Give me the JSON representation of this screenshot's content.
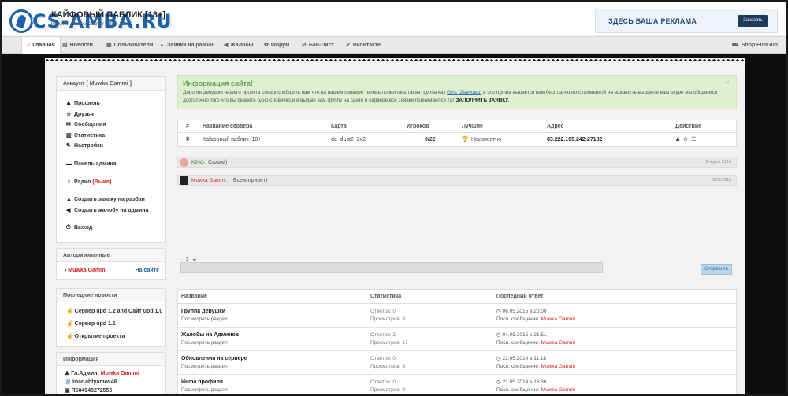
{
  "header": {
    "logo_text": "CS-AMBA.RU",
    "site_title": "КАЙФОВЫЙ ПАБЛИК [18+]",
    "site_sub": "Игровой сервер Counter-Strike 1.6",
    "ad_text": "ЗДЕСЬ ВАША РЕКЛАМА",
    "ad_button": "Заказать"
  },
  "nav": {
    "items": [
      {
        "label": "Главная",
        "icon": "home-icon"
      },
      {
        "label": "Новости",
        "icon": "newspaper-icon"
      },
      {
        "label": "Пользователи",
        "icon": "users-icon"
      },
      {
        "label": "Заявки на разбан",
        "icon": "warning-icon"
      },
      {
        "label": "Жалобы",
        "icon": "megaphone-icon"
      },
      {
        "label": "Форум",
        "icon": "forum-icon"
      },
      {
        "label": "Бан-Лист",
        "icon": "ban-icon"
      },
      {
        "label": "Вконтакте",
        "icon": "vk-icon"
      }
    ],
    "right": "Shop.FunGun"
  },
  "sidebar": {
    "account_title": "Аккаунт [ Muwka Gammi ]",
    "menu": [
      {
        "label": "Профиль",
        "icon": "user-icon"
      },
      {
        "label": "Друзья",
        "icon": "star-icon"
      },
      {
        "label": "Сообщения",
        "icon": "envelope-icon"
      },
      {
        "label": "Статистика",
        "icon": "chart-icon"
      },
      {
        "label": "Настройки",
        "icon": "wrench-icon"
      }
    ],
    "admin": "Панель админа",
    "radio": "Радио",
    "radio_state": "[Выкл]",
    "unban": "Создать заявку на разбан",
    "complaint": "Создать жалобу на админа",
    "logout": "Выход",
    "authorized_title": "Авторизованные",
    "authorized_user": "Muwka Gammi",
    "authorized_status": "На сайте",
    "news_title": "Последние новости",
    "news": [
      "Сервер upd 1.2 and Сайт upd 1.0",
      "Сервер upd 1.1",
      "Открытие проекта"
    ],
    "info_title": "Информация",
    "info_admin_label": "Гл.Админ:",
    "info_admin_name": "Muwka Gammi",
    "info_skype": "linar-ahtyamov46",
    "info_id": "R504945272555"
  },
  "alert": {
    "title": "Информация сайта!",
    "text_1": "Дорогие девушки нашего проекта спешу сообщить вам что на нашем сервере теперь появилась такая группа как",
    "link": "Girls (Девушка)",
    "text_2": "и это группа выдается вам бесплатно,но с проверкой на вшивость,вы даете ваш skype мы общаемся достаточно того что вы скажете одно словечко,и я выдаю вам группу на сайте и сервере,все заявки принимаются тут",
    "cta": "ЗАПОЛНИТЬ ЗАЯВКУ.",
    "close": "×"
  },
  "server_table": {
    "headers": [
      "#",
      "Название сервера",
      "Карта",
      "Игроков",
      "Лучшие",
      "Адрес",
      "Действие"
    ],
    "row": {
      "name": "Кайфовый паблик [18+]",
      "map": "de_dust2_2x2",
      "players": "0/22",
      "best": "Неизвестно",
      "address": "83.222.105.242:27182"
    }
  },
  "chat": {
    "messages": [
      {
        "name": "KING:",
        "text": "Салам)",
        "time": "Вчера в 15:14",
        "name_color": "#3a7a3a"
      },
      {
        "name": "Muwka Gammi:",
        "text": "Всем привет)",
        "time": "02.05.2015",
        "name_color": "#d22"
      }
    ],
    "send": "Отправить"
  },
  "forum": {
    "headers": [
      "Название",
      "Статистика",
      "Последний ответ"
    ],
    "rows": [
      {
        "title": "Группа девушки",
        "sub": "Посмотреть раздел",
        "answers": "Ответов: 0",
        "views": "Просмотров: 8",
        "date": "06.05.2015 в 20:00",
        "last_label": "Посл. сообщение:",
        "last_user": "Muwka Gammi"
      },
      {
        "title": "Жалобы на Админов",
        "sub": "Посмотреть раздел",
        "answers": "Ответов: 2",
        "views": "Просмотров: 17",
        "date": "04.05.2015 в 21:51",
        "last_label": "Посл. сообщение:",
        "last_user": "Muwka Gammi"
      },
      {
        "title": "Обновления на сервере",
        "sub": "Посмотреть раздел",
        "answers": "Ответов: 0",
        "views": "Просмотров: 3",
        "date": "22.05.2014 в 11:18",
        "last_label": "Посл. сообщение:",
        "last_user": "Muwka Gammi"
      },
      {
        "title": "Инфа профиля",
        "sub": "Посмотреть раздел",
        "answers": "Ответов: 0",
        "views": "Просмотров: 8",
        "date": "21.05.2014 в 16:36",
        "last_label": "Посл. сообщение:",
        "last_user": "Muwka Gammi"
      }
    ]
  }
}
